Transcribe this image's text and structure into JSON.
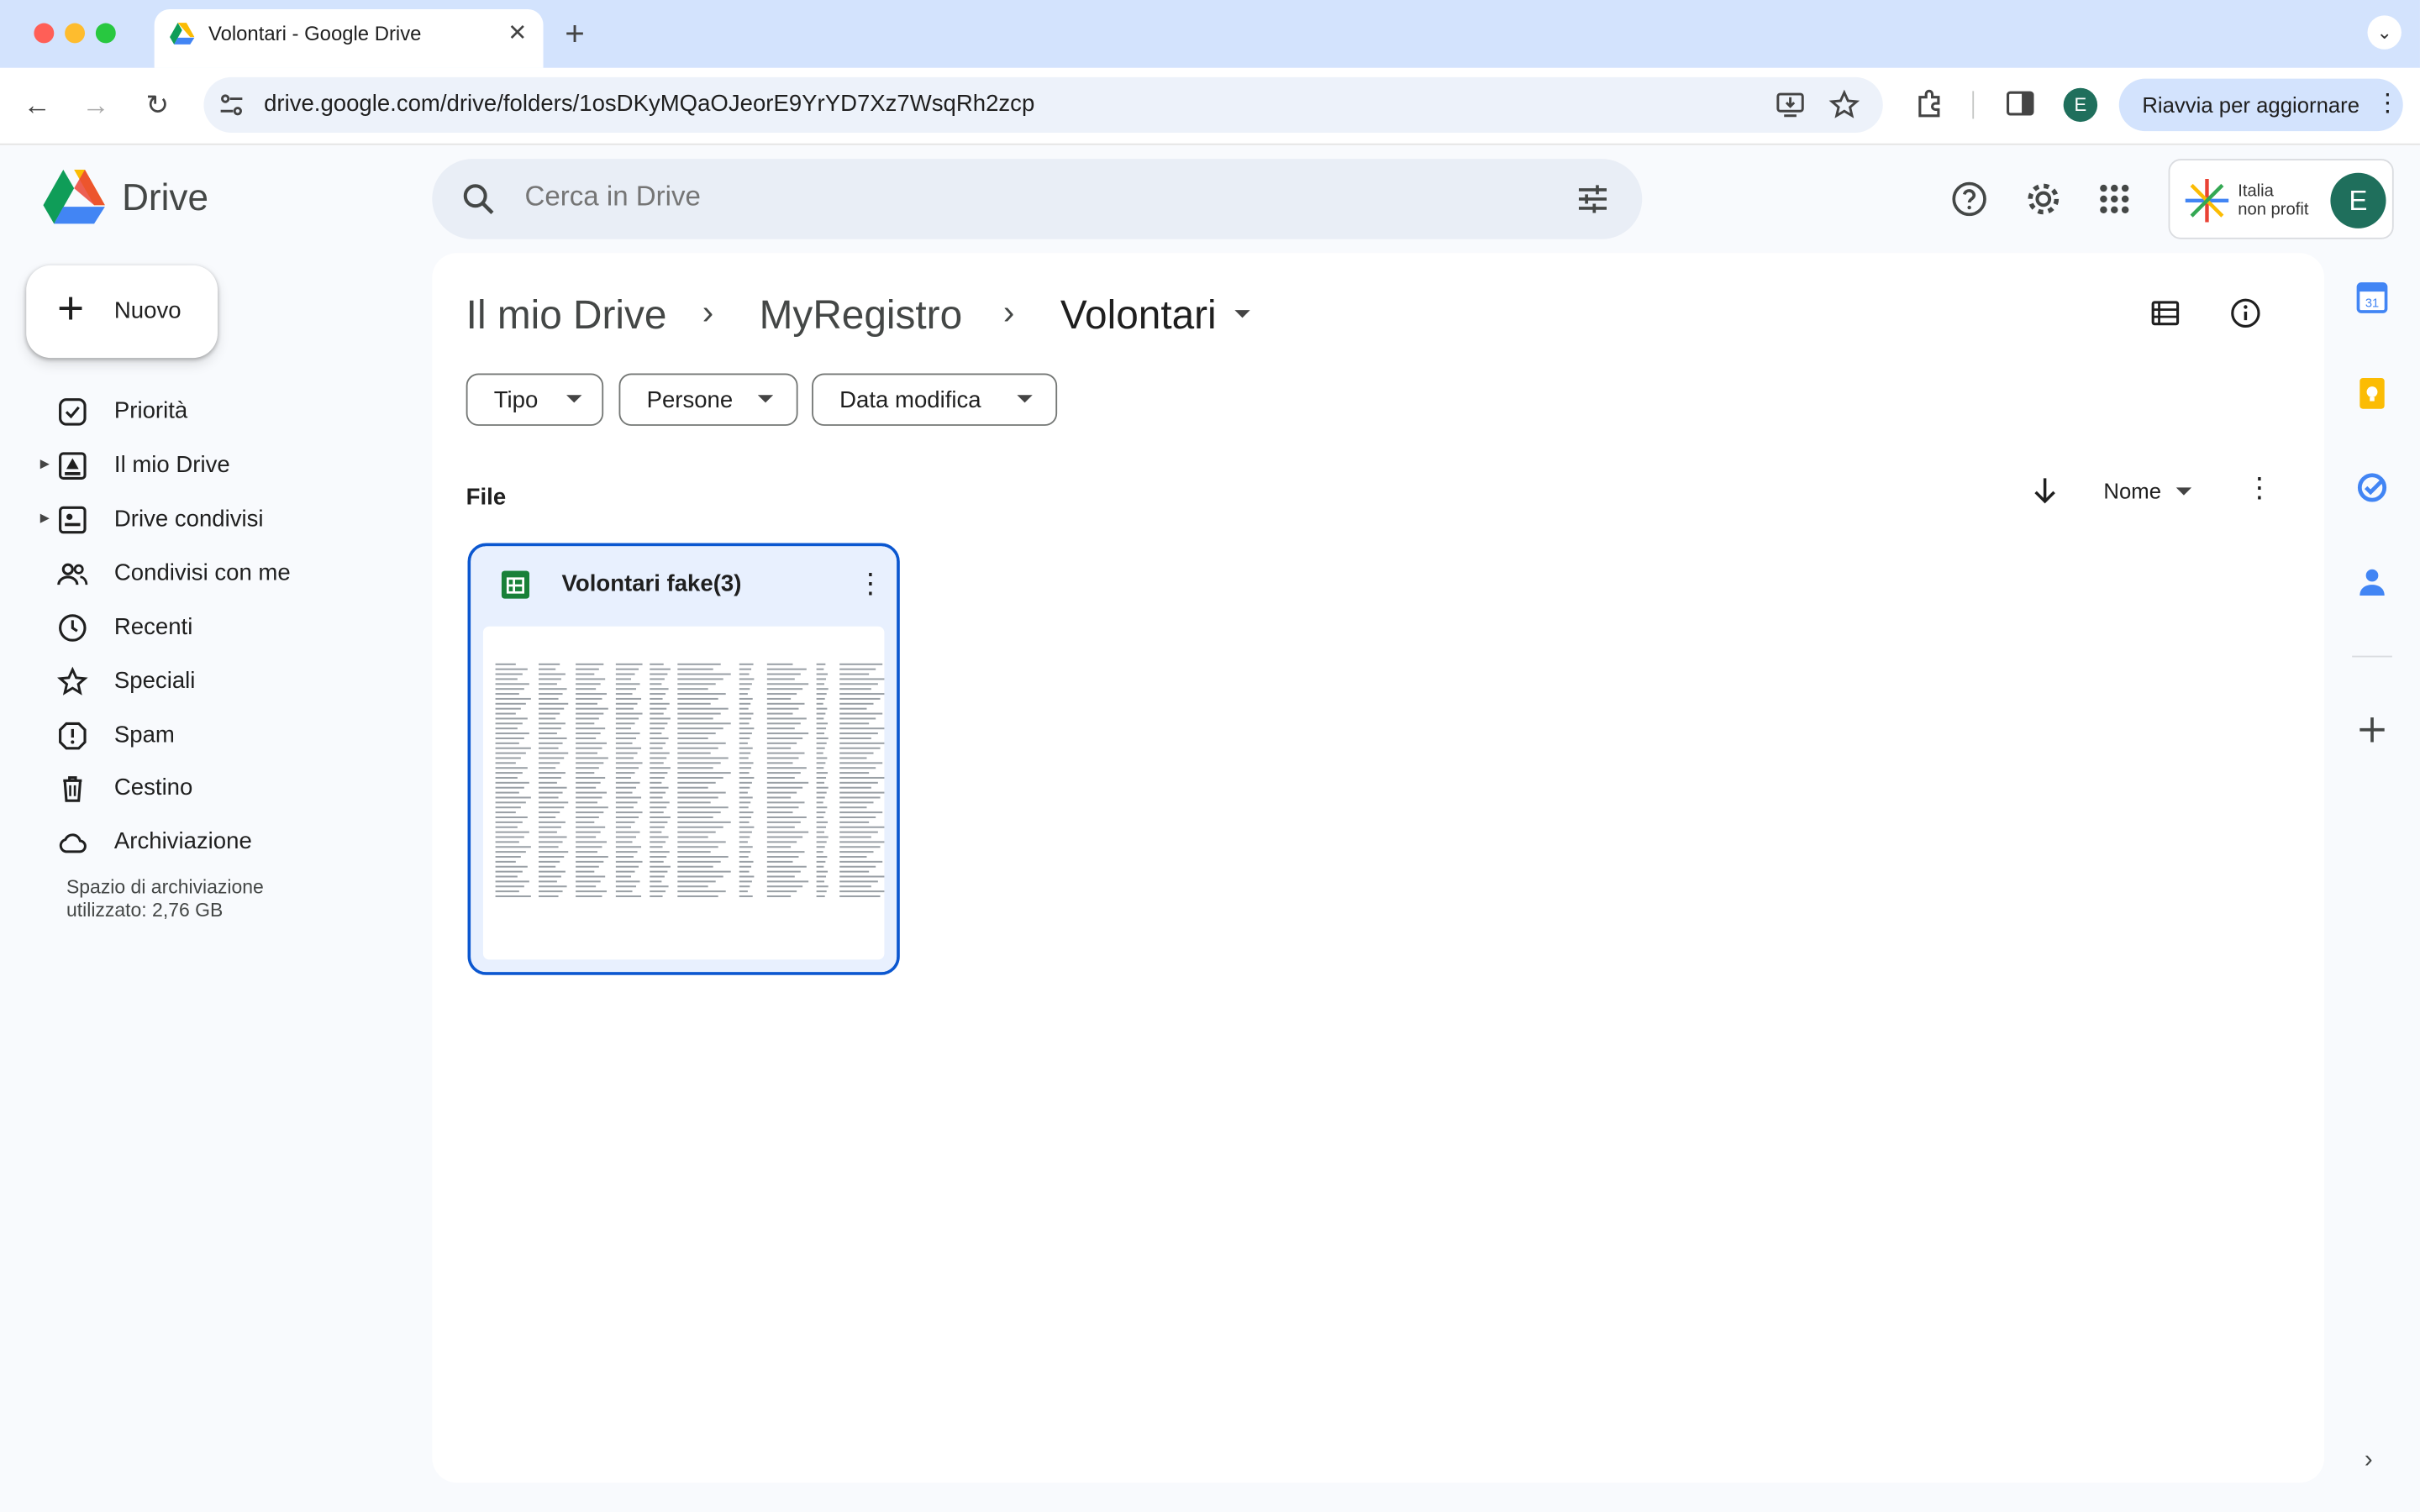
{
  "browser": {
    "tab_title": "Volontari - Google Drive",
    "url": "drive.google.com/drive/folders/1osDKyMQaOJeorE9YrYD7Xz7WsqRh2zcp",
    "profile_initial": "E",
    "update_button": "Riavvia per aggiornare",
    "icons": [
      "back-icon",
      "forward-icon",
      "reload-icon",
      "site-info-icon",
      "install-app-icon",
      "bookmark-star-icon",
      "extensions-icon",
      "side-panel-icon"
    ]
  },
  "header": {
    "app_name": "Drive",
    "search_placeholder": "Cerca in Drive",
    "org_name_line1": "Italia",
    "org_name_line2": "non profit",
    "avatar_initial": "E"
  },
  "sidebar": {
    "new_label": "Nuovo",
    "items": [
      {
        "label": "Priorità",
        "icon": "priority-check-icon"
      },
      {
        "label": "Il mio Drive",
        "icon": "my-drive-icon"
      },
      {
        "label": "Drive condivisi",
        "icon": "shared-drives-icon"
      },
      {
        "label": "Condivisi con me",
        "icon": "shared-with-me-icon"
      },
      {
        "label": "Recenti",
        "icon": "clock-icon"
      },
      {
        "label": "Speciali",
        "icon": "star-icon"
      },
      {
        "label": "Spam",
        "icon": "spam-icon"
      },
      {
        "label": "Cestino",
        "icon": "trash-icon"
      },
      {
        "label": "Archiviazione",
        "icon": "cloud-icon"
      }
    ],
    "storage_text": "Spazio di archiviazione utilizzato: 2,76 GB"
  },
  "main": {
    "breadcrumb": [
      "Il mio Drive",
      "MyRegistro",
      "Volontari"
    ],
    "filters": [
      "Tipo",
      "Persone",
      "Data modifica"
    ],
    "section_title": "File",
    "sort_label": "Nome",
    "files": [
      {
        "name": "Volontari fake(3)",
        "type": "spreadsheet"
      }
    ]
  },
  "colors": {
    "accent": "#0b57d0",
    "sheets_green": "#188038",
    "avatar": "#1f6f5c",
    "background": "#f8fafd"
  }
}
